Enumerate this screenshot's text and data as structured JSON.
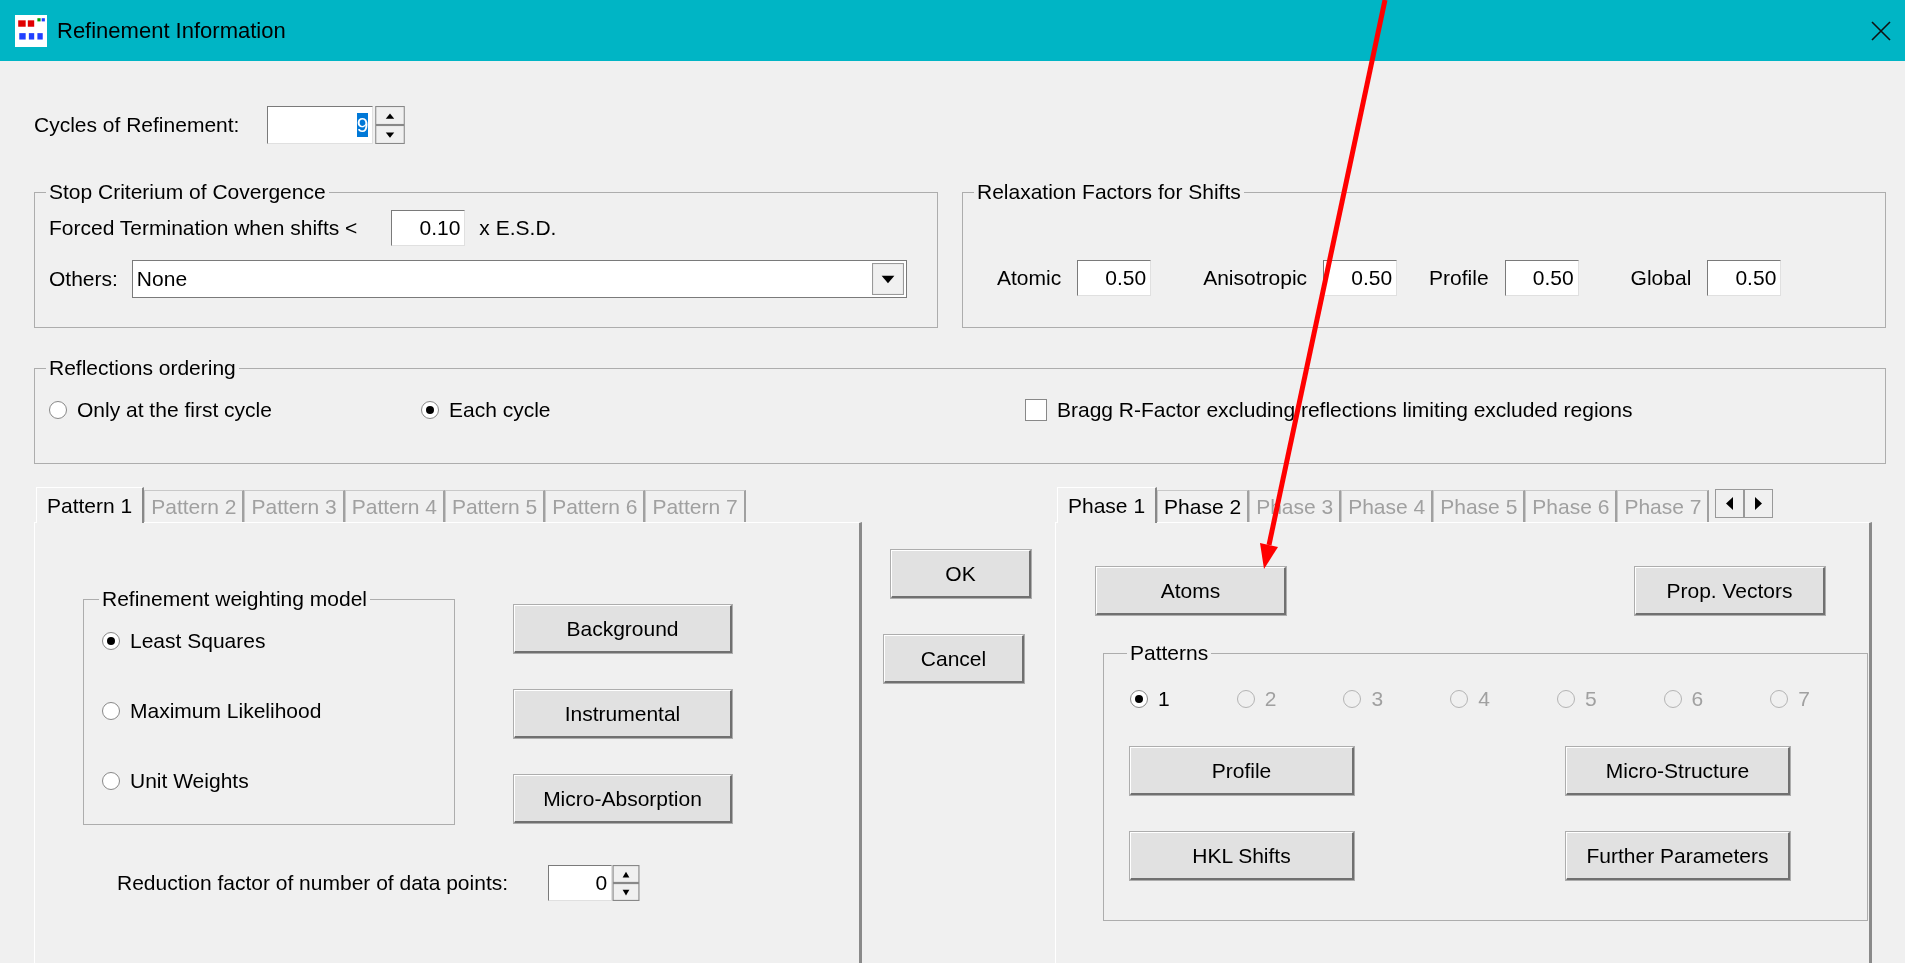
{
  "window": {
    "title": "Refinement Information"
  },
  "cycles": {
    "label": "Cycles of Refinement:",
    "value": "9"
  },
  "stop_criterium": {
    "title": "Stop Criterium of Covergence",
    "forced_label": "Forced Termination when  shifts <",
    "forced_value": "0.10",
    "forced_unit": "x E.S.D.",
    "others_label": "Others:",
    "others_value": "None"
  },
  "relaxation": {
    "title": "Relaxation Factors for Shifts",
    "factors": [
      {
        "label": "Atomic",
        "value": "0.50"
      },
      {
        "label": "Anisotropic",
        "value": "0.50"
      },
      {
        "label": "Profile",
        "value": "0.50"
      },
      {
        "label": "Global",
        "value": "0.50"
      }
    ]
  },
  "reflections_ordering": {
    "title": "Reflections ordering",
    "options": [
      {
        "label": "Only at the first cycle",
        "selected": false
      },
      {
        "label": "Each cycle",
        "selected": true
      }
    ],
    "bragg": {
      "label": "Bragg R-Factor excluding  reflections limiting excluded regions",
      "checked": false
    }
  },
  "pattern_tabs": [
    {
      "label": "Pattern 1",
      "selected": true,
      "disabled": false
    },
    {
      "label": "Pattern 2",
      "selected": false,
      "disabled": true
    },
    {
      "label": "Pattern 3",
      "selected": false,
      "disabled": true
    },
    {
      "label": "Pattern 4",
      "selected": false,
      "disabled": true
    },
    {
      "label": "Pattern 5",
      "selected": false,
      "disabled": true
    },
    {
      "label": "Pattern 6",
      "selected": false,
      "disabled": true
    },
    {
      "label": "Pattern 7",
      "selected": false,
      "disabled": true
    }
  ],
  "pattern_panel": {
    "weighting": {
      "title": "Refinement weighting model",
      "options": [
        {
          "label": "Least Squares",
          "selected": true
        },
        {
          "label": "Maximum Likelihood",
          "selected": false
        },
        {
          "label": "Unit Weights",
          "selected": false
        }
      ]
    },
    "buttons": [
      "Background",
      "Instrumental",
      "Micro-Absorption"
    ],
    "reduction": {
      "label": "Reduction factor of number of data points:",
      "value": "0"
    }
  },
  "dialog_buttons": [
    "OK",
    "Cancel"
  ],
  "phase_tabs": [
    {
      "label": "Phase 1",
      "selected": true,
      "disabled": false
    },
    {
      "label": "Phase 2",
      "selected": false,
      "disabled": false
    },
    {
      "label": "Phase 3",
      "selected": false,
      "disabled": true
    },
    {
      "label": "Phase 4",
      "selected": false,
      "disabled": true
    },
    {
      "label": "Phase 5",
      "selected": false,
      "disabled": true
    },
    {
      "label": "Phase 6",
      "selected": false,
      "disabled": true
    },
    {
      "label": "Phase 7",
      "selected": false,
      "disabled": true
    }
  ],
  "phase_panel": {
    "top_buttons": [
      "Atoms",
      "Prop. Vectors"
    ],
    "patterns": {
      "title": "Patterns",
      "options": [
        {
          "label": "1",
          "selected": true,
          "disabled": false
        },
        {
          "label": "2",
          "selected": false,
          "disabled": true
        },
        {
          "label": "3",
          "selected": false,
          "disabled": true
        },
        {
          "label": "4",
          "selected": false,
          "disabled": true
        },
        {
          "label": "5",
          "selected": false,
          "disabled": true
        },
        {
          "label": "6",
          "selected": false,
          "disabled": true
        },
        {
          "label": "7",
          "selected": false,
          "disabled": true
        }
      ]
    },
    "buttons": [
      "Profile",
      "Micro-Structure",
      "HKL Shifts",
      "Further Parameters"
    ]
  }
}
